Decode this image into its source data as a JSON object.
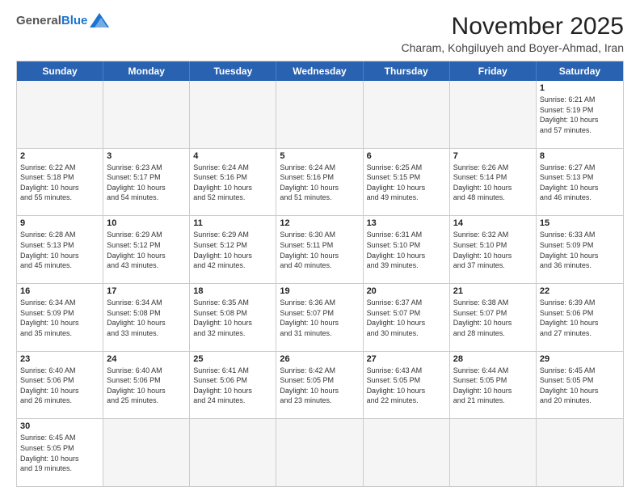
{
  "header": {
    "logo_general": "General",
    "logo_blue": "Blue",
    "month_title": "November 2025",
    "location": "Charam, Kohgiluyeh and Boyer-Ahmad, Iran"
  },
  "weekdays": [
    "Sunday",
    "Monday",
    "Tuesday",
    "Wednesday",
    "Thursday",
    "Friday",
    "Saturday"
  ],
  "rows": [
    [
      {
        "day": "",
        "info": ""
      },
      {
        "day": "",
        "info": ""
      },
      {
        "day": "",
        "info": ""
      },
      {
        "day": "",
        "info": ""
      },
      {
        "day": "",
        "info": ""
      },
      {
        "day": "",
        "info": ""
      },
      {
        "day": "1",
        "info": "Sunrise: 6:21 AM\nSunset: 5:19 PM\nDaylight: 10 hours\nand 57 minutes."
      }
    ],
    [
      {
        "day": "2",
        "info": "Sunrise: 6:22 AM\nSunset: 5:18 PM\nDaylight: 10 hours\nand 55 minutes."
      },
      {
        "day": "3",
        "info": "Sunrise: 6:23 AM\nSunset: 5:17 PM\nDaylight: 10 hours\nand 54 minutes."
      },
      {
        "day": "4",
        "info": "Sunrise: 6:24 AM\nSunset: 5:16 PM\nDaylight: 10 hours\nand 52 minutes."
      },
      {
        "day": "5",
        "info": "Sunrise: 6:24 AM\nSunset: 5:16 PM\nDaylight: 10 hours\nand 51 minutes."
      },
      {
        "day": "6",
        "info": "Sunrise: 6:25 AM\nSunset: 5:15 PM\nDaylight: 10 hours\nand 49 minutes."
      },
      {
        "day": "7",
        "info": "Sunrise: 6:26 AM\nSunset: 5:14 PM\nDaylight: 10 hours\nand 48 minutes."
      },
      {
        "day": "8",
        "info": "Sunrise: 6:27 AM\nSunset: 5:13 PM\nDaylight: 10 hours\nand 46 minutes."
      }
    ],
    [
      {
        "day": "9",
        "info": "Sunrise: 6:28 AM\nSunset: 5:13 PM\nDaylight: 10 hours\nand 45 minutes."
      },
      {
        "day": "10",
        "info": "Sunrise: 6:29 AM\nSunset: 5:12 PM\nDaylight: 10 hours\nand 43 minutes."
      },
      {
        "day": "11",
        "info": "Sunrise: 6:29 AM\nSunset: 5:12 PM\nDaylight: 10 hours\nand 42 minutes."
      },
      {
        "day": "12",
        "info": "Sunrise: 6:30 AM\nSunset: 5:11 PM\nDaylight: 10 hours\nand 40 minutes."
      },
      {
        "day": "13",
        "info": "Sunrise: 6:31 AM\nSunset: 5:10 PM\nDaylight: 10 hours\nand 39 minutes."
      },
      {
        "day": "14",
        "info": "Sunrise: 6:32 AM\nSunset: 5:10 PM\nDaylight: 10 hours\nand 37 minutes."
      },
      {
        "day": "15",
        "info": "Sunrise: 6:33 AM\nSunset: 5:09 PM\nDaylight: 10 hours\nand 36 minutes."
      }
    ],
    [
      {
        "day": "16",
        "info": "Sunrise: 6:34 AM\nSunset: 5:09 PM\nDaylight: 10 hours\nand 35 minutes."
      },
      {
        "day": "17",
        "info": "Sunrise: 6:34 AM\nSunset: 5:08 PM\nDaylight: 10 hours\nand 33 minutes."
      },
      {
        "day": "18",
        "info": "Sunrise: 6:35 AM\nSunset: 5:08 PM\nDaylight: 10 hours\nand 32 minutes."
      },
      {
        "day": "19",
        "info": "Sunrise: 6:36 AM\nSunset: 5:07 PM\nDaylight: 10 hours\nand 31 minutes."
      },
      {
        "day": "20",
        "info": "Sunrise: 6:37 AM\nSunset: 5:07 PM\nDaylight: 10 hours\nand 30 minutes."
      },
      {
        "day": "21",
        "info": "Sunrise: 6:38 AM\nSunset: 5:07 PM\nDaylight: 10 hours\nand 28 minutes."
      },
      {
        "day": "22",
        "info": "Sunrise: 6:39 AM\nSunset: 5:06 PM\nDaylight: 10 hours\nand 27 minutes."
      }
    ],
    [
      {
        "day": "23",
        "info": "Sunrise: 6:40 AM\nSunset: 5:06 PM\nDaylight: 10 hours\nand 26 minutes."
      },
      {
        "day": "24",
        "info": "Sunrise: 6:40 AM\nSunset: 5:06 PM\nDaylight: 10 hours\nand 25 minutes."
      },
      {
        "day": "25",
        "info": "Sunrise: 6:41 AM\nSunset: 5:06 PM\nDaylight: 10 hours\nand 24 minutes."
      },
      {
        "day": "26",
        "info": "Sunrise: 6:42 AM\nSunset: 5:05 PM\nDaylight: 10 hours\nand 23 minutes."
      },
      {
        "day": "27",
        "info": "Sunrise: 6:43 AM\nSunset: 5:05 PM\nDaylight: 10 hours\nand 22 minutes."
      },
      {
        "day": "28",
        "info": "Sunrise: 6:44 AM\nSunset: 5:05 PM\nDaylight: 10 hours\nand 21 minutes."
      },
      {
        "day": "29",
        "info": "Sunrise: 6:45 AM\nSunset: 5:05 PM\nDaylight: 10 hours\nand 20 minutes."
      }
    ],
    [
      {
        "day": "30",
        "info": "Sunrise: 6:45 AM\nSunset: 5:05 PM\nDaylight: 10 hours\nand 19 minutes."
      },
      {
        "day": "",
        "info": ""
      },
      {
        "day": "",
        "info": ""
      },
      {
        "day": "",
        "info": ""
      },
      {
        "day": "",
        "info": ""
      },
      {
        "day": "",
        "info": ""
      },
      {
        "day": "",
        "info": ""
      }
    ]
  ]
}
